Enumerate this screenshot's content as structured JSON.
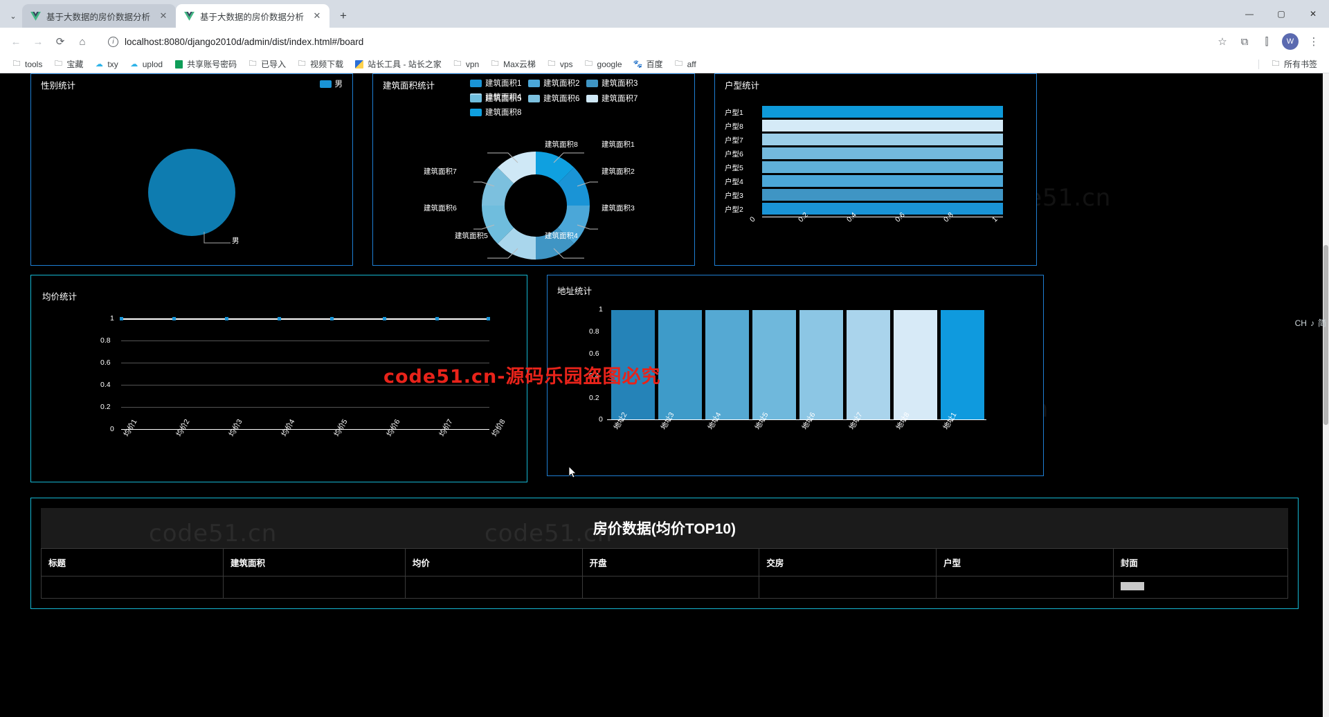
{
  "browser": {
    "tabs": [
      {
        "title": "基于大数据的房价数据分析",
        "favicon": "vue-logo-icon",
        "active": false
      },
      {
        "title": "基于大数据的房价数据分析",
        "favicon": "vue-logo-icon",
        "active": true
      }
    ],
    "new_tab_label": "+",
    "tab_list_label": "⌄",
    "window_controls": {
      "minimize": "—",
      "maximize": "▢",
      "close": "✕"
    },
    "nav": {
      "back": "←",
      "forward": "→",
      "reload": "⟳",
      "home": "⌂",
      "url": "localhost:8080/django2010d/admin/dist/index.html#/board",
      "info_icon": "ⓘ",
      "star": "☆",
      "extensions": "⧉",
      "split": "⫿",
      "profile_initial": "W",
      "menu": "⋮"
    },
    "bookmarks": [
      {
        "label": "tools",
        "icon": "folder-icon"
      },
      {
        "label": "宝藏",
        "icon": "folder-icon"
      },
      {
        "label": "txy",
        "icon": "cloud-icon"
      },
      {
        "label": "uplod",
        "icon": "cloud-upload-icon"
      },
      {
        "label": "共享账号密码",
        "icon": "sheets-icon"
      },
      {
        "label": "已导入",
        "icon": "folder-icon"
      },
      {
        "label": "视频下载",
        "icon": "folder-icon"
      },
      {
        "label": "站长工具 - 站长之家",
        "icon": "chinaz-icon"
      },
      {
        "label": "vpn",
        "icon": "folder-icon"
      },
      {
        "label": "Max云梯",
        "icon": "folder-icon"
      },
      {
        "label": "vps",
        "icon": "folder-icon"
      },
      {
        "label": "google",
        "icon": "folder-icon"
      },
      {
        "label": "百度",
        "icon": "baidu-icon"
      },
      {
        "label": "aff",
        "icon": "folder-icon"
      }
    ],
    "all_bookmarks": {
      "label": "所有书签",
      "icon": "folder-icon"
    }
  },
  "watermarks": {
    "text": "code51.cn",
    "red_banner": "code51.cn-源码乐园盗图必究"
  },
  "ime": {
    "lang": "CH",
    "mode": "简",
    "music": "♪"
  },
  "colors": {
    "panel_border_blue": "#1e7fd4",
    "panel_border_teal": "#15b8d4",
    "accent1": "#0e86c8",
    "accent2": "#1a94d6",
    "background": "#000000"
  },
  "chart_data": [
    {
      "type": "pie",
      "title": "性别统计",
      "panel": "gender",
      "legend": [
        {
          "label": "男",
          "color": "#1a94d6"
        }
      ],
      "labels": [
        "男"
      ],
      "values": [
        1
      ],
      "slices": [
        {
          "name": "男",
          "value": 1,
          "color": "#0e7cb0",
          "percent": 100
        }
      ],
      "label_line": "男"
    },
    {
      "type": "pie",
      "title": "建筑面积统计",
      "panel": "area",
      "donut": true,
      "legend": [
        {
          "label": "建筑面积1",
          "color": "#1a94d6"
        },
        {
          "label": "建筑面积2",
          "color": "#4ba7d8"
        },
        {
          "label": "建筑面积3",
          "color": "#3f95c4"
        },
        {
          "label": "建筑面积4",
          "color": "#a9d6ec"
        },
        {
          "label": "建筑面积5",
          "color": "#6fbddd"
        },
        {
          "label": "建筑面积6",
          "color": "#7cc0de"
        },
        {
          "label": "建筑面积7",
          "color": "#cfe8f6"
        },
        {
          "label": "建筑面积8",
          "color": "#0fa0e0"
        }
      ],
      "labels": [
        "建筑面积1",
        "建筑面积2",
        "建筑面积3",
        "建筑面积4",
        "建筑面积5",
        "建筑面积6",
        "建筑面积7",
        "建筑面积8"
      ],
      "values": [
        1,
        1,
        1,
        1,
        1,
        1,
        1,
        1
      ],
      "slices": [
        {
          "name": "建筑面积1",
          "value": 1,
          "color": "#1a94d6"
        },
        {
          "name": "建筑面积2",
          "value": 1,
          "color": "#4ba7d8"
        },
        {
          "name": "建筑面积3",
          "value": 1,
          "color": "#3f95c4"
        },
        {
          "name": "建筑面积4",
          "value": 1,
          "color": "#a9d6ec"
        },
        {
          "name": "建筑面积5",
          "value": 1,
          "color": "#6fbddd"
        },
        {
          "name": "建筑面积6",
          "value": 1,
          "color": "#7cc0de"
        },
        {
          "name": "建筑面积7",
          "value": 1,
          "color": "#cfe8f6"
        },
        {
          "name": "建筑面积8",
          "value": 1,
          "color": "#0fa0e0"
        }
      ]
    },
    {
      "type": "bar",
      "orientation": "horizontal",
      "title": "户型统计",
      "panel": "housetype",
      "categories": [
        "户型2",
        "户型3",
        "户型4",
        "户型5",
        "户型6",
        "户型7",
        "户型8",
        "户型1"
      ],
      "values": [
        1,
        1,
        1,
        1,
        1,
        1,
        1,
        1
      ],
      "bar_colors": [
        "#1a94d6",
        "#3f95c4",
        "#4ba7d8",
        "#5fb0d8",
        "#73b9dd",
        "#9ccfe9",
        "#d5eaf7",
        "#0e9ada"
      ],
      "xticks": [
        "0",
        "0.2",
        "0.4",
        "0.6",
        "0.8",
        "1"
      ],
      "xlim": [
        0,
        1
      ],
      "grid": true
    },
    {
      "type": "line",
      "title": "均价统计",
      "panel": "avgprice",
      "categories": [
        "均价1",
        "均价2",
        "均价3",
        "均价4",
        "均价5",
        "均价6",
        "均价7",
        "均价8"
      ],
      "values": [
        1,
        1,
        1,
        1,
        1,
        1,
        1,
        1
      ],
      "yticks": [
        "0",
        "0.2",
        "0.4",
        "0.6",
        "0.8",
        "1"
      ],
      "ylim": [
        0,
        1
      ],
      "line_color": "#ffffff",
      "grid": true
    },
    {
      "type": "bar",
      "orientation": "vertical",
      "title": "地址统计",
      "panel": "address",
      "categories": [
        "地址2",
        "地址3",
        "地址4",
        "地址5",
        "地址6",
        "地址7",
        "地址8",
        "地址1"
      ],
      "values": [
        1,
        1,
        1,
        1,
        1,
        1,
        1,
        1
      ],
      "bar_colors": [
        "#2583b8",
        "#3e9bc9",
        "#55a9d3",
        "#6fb8dc",
        "#8cc6e4",
        "#aad4ec",
        "#d7eaf7",
        "#0f9ade"
      ],
      "yticks": [
        "0",
        "0.2",
        "0.4",
        "0.6",
        "0.8",
        "1"
      ],
      "ylim": [
        0,
        1
      ],
      "grid": false
    }
  ],
  "table": {
    "title": "房价数据(均价TOP10)",
    "columns": [
      "标题",
      "建筑面积",
      "均价",
      "开盘",
      "交房",
      "户型",
      "封面"
    ],
    "rows": []
  }
}
